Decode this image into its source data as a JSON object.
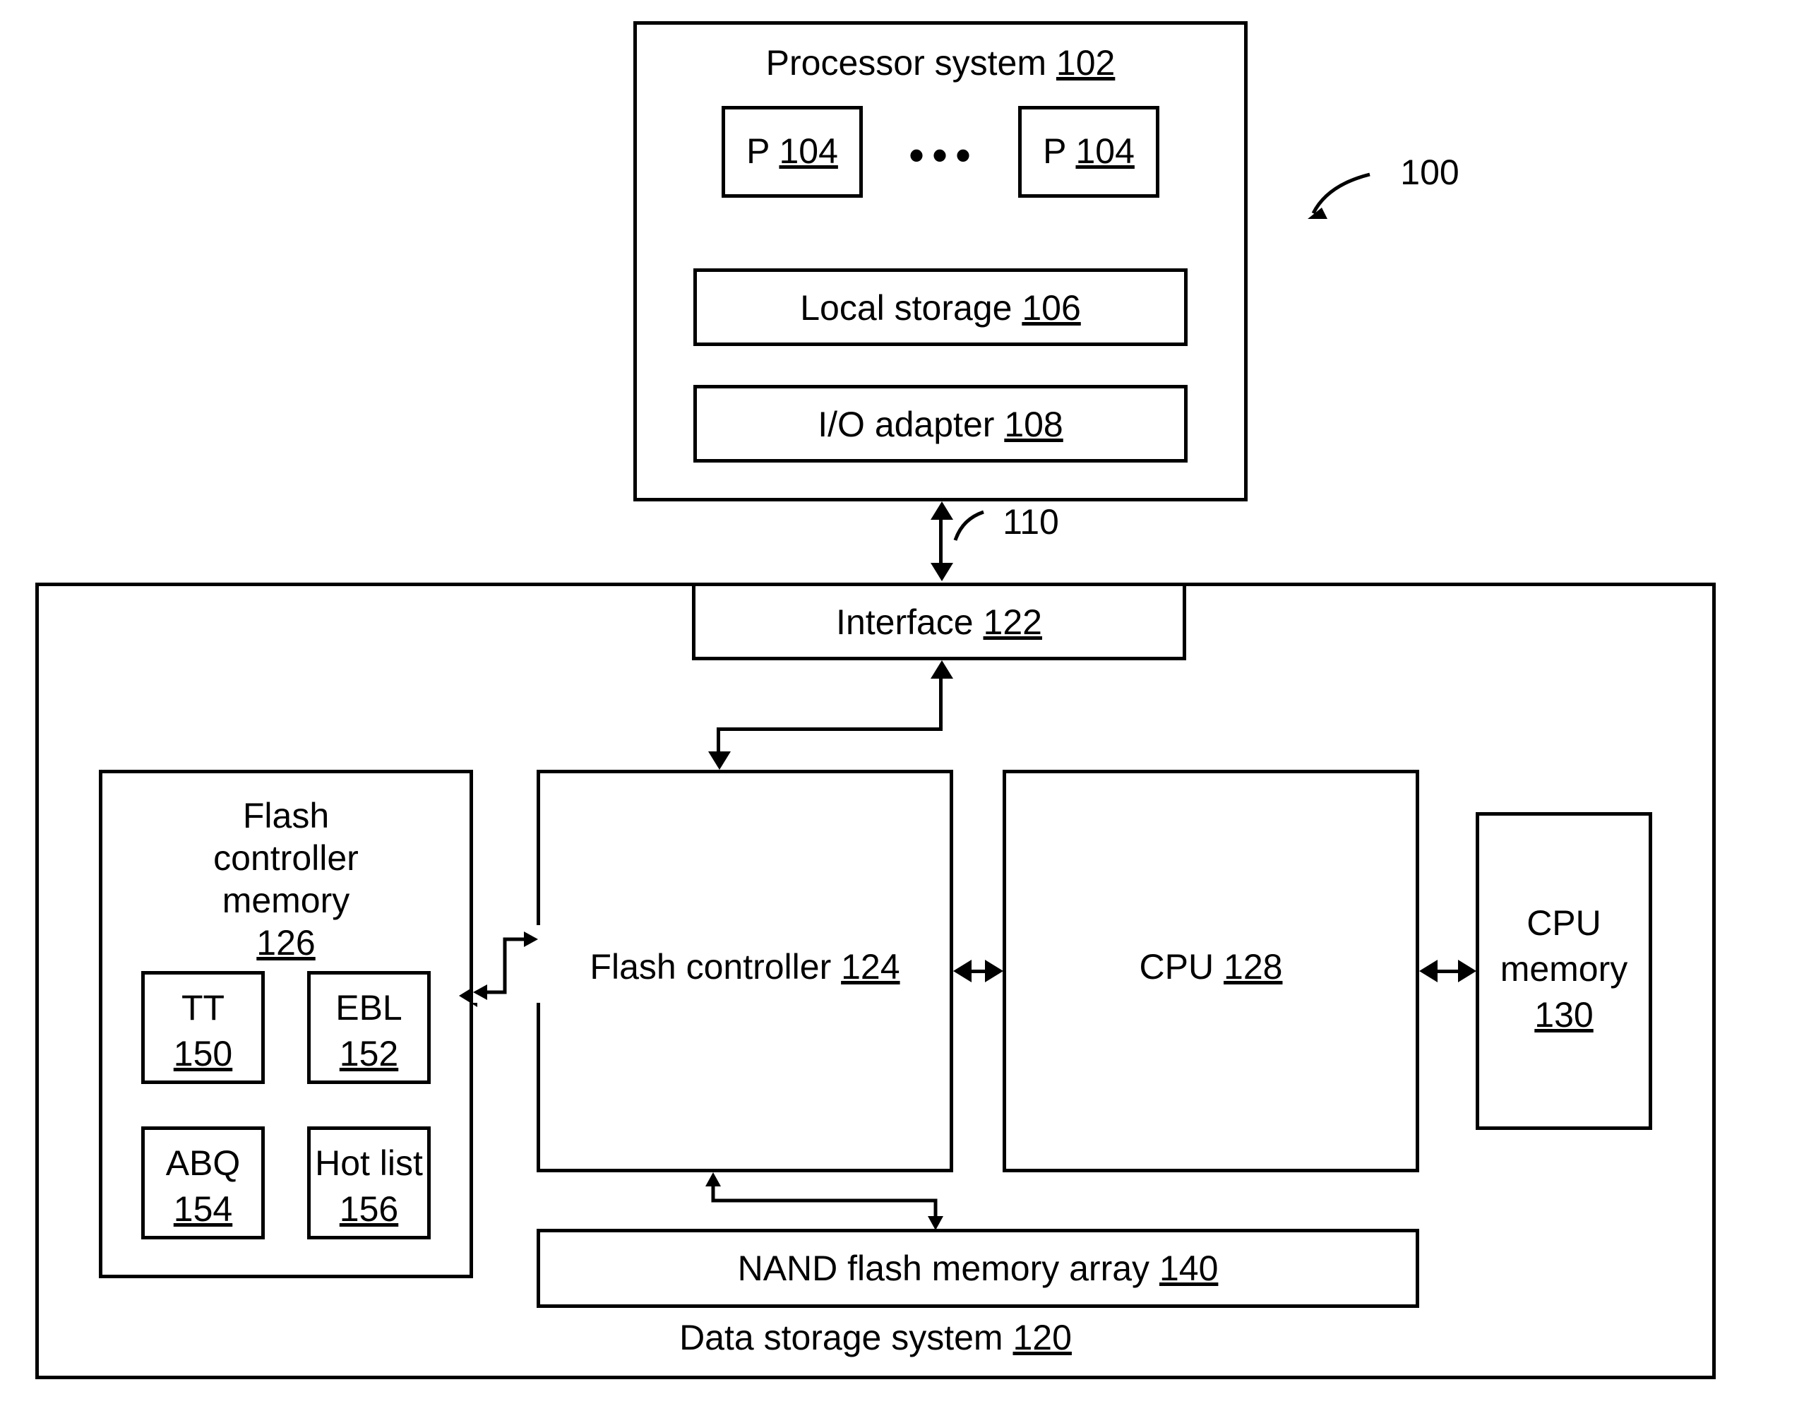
{
  "figure_ref": "100",
  "processor_system": {
    "title": "Processor system",
    "ref": "102",
    "p1": {
      "label": "P",
      "ref": "104"
    },
    "p2": {
      "label": "P",
      "ref": "104"
    },
    "local_storage": {
      "label": "Local storage",
      "ref": "106"
    },
    "io_adapter": {
      "label": "I/O adapter",
      "ref": "108"
    }
  },
  "link_ref": "110",
  "data_storage_system": {
    "title": "Data storage system",
    "ref": "120",
    "interface": {
      "label": "Interface",
      "ref": "122"
    },
    "flash_controller": {
      "label": "Flash controller",
      "ref": "124"
    },
    "flash_controller_memory": {
      "title": "Flash controller memory",
      "ref": "126",
      "tt": {
        "label": "TT",
        "ref": "150"
      },
      "ebl": {
        "label": "EBL",
        "ref": "152"
      },
      "abq": {
        "label": "ABQ",
        "ref": "154"
      },
      "hotlist": {
        "label": "Hot list",
        "ref": "156"
      }
    },
    "cpu": {
      "label": "CPU",
      "ref": "128"
    },
    "cpu_memory": {
      "label1": "CPU",
      "label2": "memory",
      "ref": "130"
    },
    "nand": {
      "label": "NAND flash memory array",
      "ref": "140"
    }
  }
}
